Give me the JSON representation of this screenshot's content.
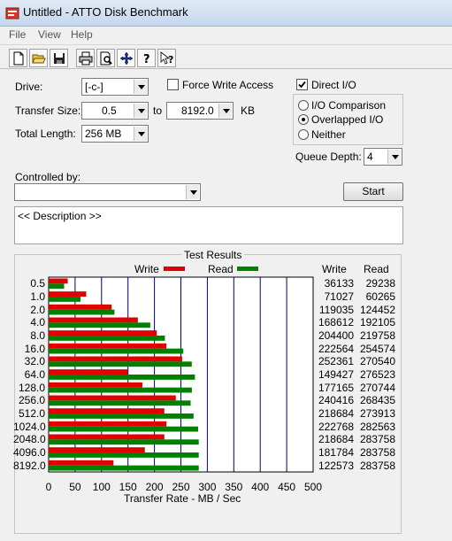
{
  "window": {
    "title": "Untitled - ATTO Disk Benchmark"
  },
  "menu": {
    "items": [
      "File",
      "View",
      "Help"
    ]
  },
  "toolbar": {
    "icons": [
      "new-document-icon",
      "open-folder-icon",
      "save-icon",
      "print-icon",
      "print-preview-icon",
      "move-icon",
      "help-icon",
      "context-help-icon"
    ]
  },
  "settings": {
    "drive_label": "Drive:",
    "drive_value": "[-c-]",
    "force_write_label": "Force Write Access",
    "force_write_checked": false,
    "direct_io_label": "Direct I/O",
    "direct_io_checked": true,
    "transfer_size_label": "Transfer Size:",
    "transfer_from": "0.5",
    "to_label": "to",
    "transfer_to": "8192.0",
    "kb_label": "KB",
    "total_length_label": "Total Length:",
    "total_length_value": "256 MB",
    "io_comparison_label": "I/O Comparison",
    "overlapped_io_label": "Overlapped I/O",
    "neither_label": "Neither",
    "selected_mode": "Overlapped I/O",
    "queue_depth_label": "Queue Depth:",
    "queue_depth_value": "4",
    "controlled_by_label": "Controlled by:",
    "controlled_by_value": "",
    "start_label": "Start",
    "description_text": "<< Description >>"
  },
  "results": {
    "title": "Test Results",
    "write_legend": "Write",
    "read_legend": "Read",
    "write_header": "Write",
    "read_header": "Read",
    "write_color": "#e00000",
    "read_color": "#008000",
    "grid_color": "#00006a",
    "x_axis_label": "Transfer Rate - MB / Sec"
  },
  "chart_data": {
    "type": "bar",
    "title": "Test Results",
    "xlabel": "Transfer Rate - MB / Sec",
    "ylabel": "",
    "xlim": [
      0,
      500
    ],
    "x_ticks": [
      "0",
      "50",
      "100",
      "150",
      "200",
      "250",
      "300",
      "350",
      "400",
      "450",
      "500"
    ],
    "categories": [
      "0.5",
      "1.0",
      "2.0",
      "4.0",
      "8.0",
      "16.0",
      "32.0",
      "64.0",
      "128.0",
      "256.0",
      "512.0",
      "1024.0",
      "2048.0",
      "4096.0",
      "8192.0"
    ],
    "series": [
      {
        "name": "Write",
        "values": [
          36133,
          71027,
          119035,
          168612,
          204400,
          222564,
          252361,
          149427,
          177165,
          240416,
          218684,
          222768,
          218684,
          181784,
          122573
        ]
      },
      {
        "name": "Read",
        "values": [
          29238,
          60265,
          124452,
          192105,
          219758,
          254574,
          270540,
          276523,
          270744,
          268435,
          273913,
          282563,
          283758,
          283758,
          283758
        ]
      }
    ],
    "value_unit": "KB/s",
    "grid": true,
    "legend": "top"
  }
}
